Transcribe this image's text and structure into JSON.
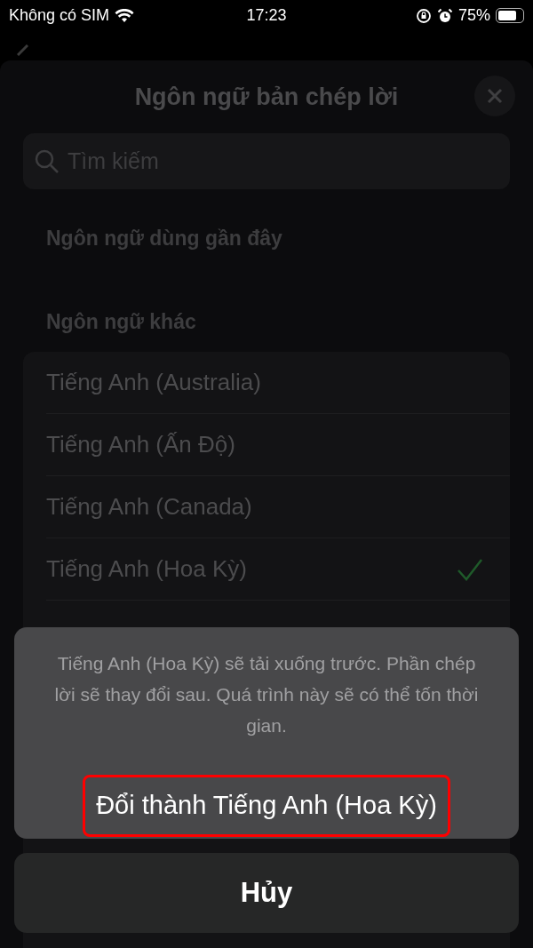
{
  "status_bar": {
    "carrier": "Không có SIM",
    "time": "17:23",
    "battery": "75%"
  },
  "sheet": {
    "title": "Ngôn ngữ bản chép lời",
    "search": {
      "placeholder": "Tìm kiếm"
    },
    "sections": [
      "Ngôn ngữ dùng gần đây",
      "Ngôn ngữ khác"
    ],
    "languages": [
      {
        "label": "Tiếng Anh (Australia)",
        "selected": false
      },
      {
        "label": "Tiếng Anh (Ấn Độ)",
        "selected": false
      },
      {
        "label": "Tiếng Anh (Canada)",
        "selected": false
      },
      {
        "label": "Tiếng Anh (Hoa Kỳ)",
        "selected": true
      }
    ]
  },
  "action_sheet": {
    "message": "Tiếng Anh (Hoa Kỳ) sẽ tải xuống trước. Phần chép lời sẽ thay đổi sau. Quá trình này sẽ có thể tốn thời gian.",
    "action": {
      "label": "Đổi thành Tiếng Anh (Hoa Kỳ)",
      "highlighted": true
    },
    "cancel": "Hủy"
  }
}
